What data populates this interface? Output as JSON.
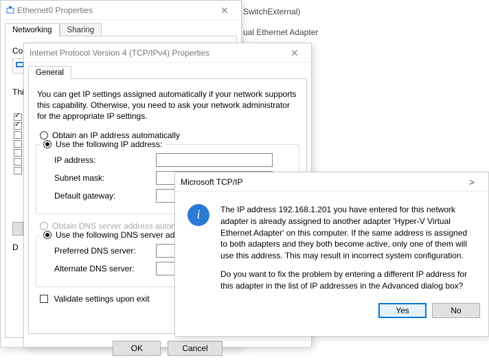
{
  "bg": {
    "line1_suffix": "SwitchExternal)",
    "line2_suffix": "ual Ethernet Adapter"
  },
  "win1": {
    "title": "Ethernet0 Properties",
    "tabs": {
      "networking": "Networking",
      "sharing": "Sharing"
    },
    "connect_label_partial": "Co",
    "this_label_partial": "Thi",
    "desc_partial": "D"
  },
  "win2": {
    "title": "Internet Protocol Version 4 (TCP/IPv4) Properties",
    "tab_general": "General",
    "intro": "You can get IP settings assigned automatically if your network supports this capability. Otherwise, you need to ask your network administrator for the appropriate IP settings.",
    "radio_auto_ip": "Obtain an IP address automatically",
    "radio_static_ip": "Use the following IP address:",
    "lbl_ip": "IP address:",
    "lbl_mask": "Subnet mask:",
    "lbl_gw": "Default gateway:",
    "radio_auto_dns": "Obtain DNS server address automat",
    "radio_static_dns": "Use the following DNS server addre",
    "lbl_dns1": "Preferred DNS server:",
    "lbl_dns2": "Alternate DNS server:",
    "chk_validate": "Validate settings upon exit",
    "btn_ok": "OK",
    "btn_cancel": "Cancel"
  },
  "msg": {
    "title": "Microsoft TCP/IP",
    "para1": "The IP address 192.168.1.201 you have entered for this network adapter is already assigned to another adapter 'Hyper-V Virtual Ethernet Adapter' on this computer. If the same address is assigned to both adapters and they both become active, only one of them will use this address.  This may result in incorrect system configuration.",
    "para2": "Do you want to fix the problem by entering a different IP address for this adapter in the list of IP addresses in the Advanced dialog box?",
    "btn_yes": "Yes",
    "btn_no": "No"
  }
}
